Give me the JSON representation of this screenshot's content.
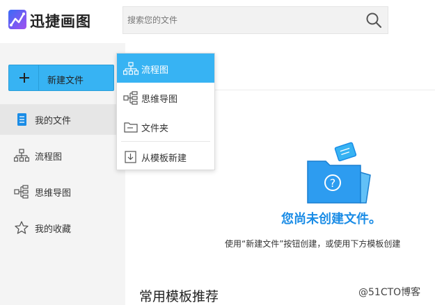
{
  "header": {
    "app_title": "迅捷画图",
    "search": {
      "placeholder": "搜索您的文件",
      "value": ""
    }
  },
  "sidebar": {
    "new_button_label": "新建文件",
    "items": [
      {
        "label": "我的文件",
        "icon": "document-icon",
        "active": true
      },
      {
        "label": "流程图",
        "icon": "flowchart-icon",
        "active": false
      },
      {
        "label": "思维导图",
        "icon": "mindmap-icon",
        "active": false
      },
      {
        "label": "我的收藏",
        "icon": "star-icon",
        "active": false
      }
    ]
  },
  "dropdown": {
    "items": [
      {
        "label": "流程图",
        "icon": "flowchart-icon",
        "highlighted": true
      },
      {
        "label": "思维导图",
        "icon": "mindmap-icon",
        "highlighted": false
      },
      {
        "label": "文件夹",
        "icon": "folder-icon",
        "highlighted": false
      },
      {
        "label": "从模板新建",
        "icon": "template-icon",
        "highlighted": false
      }
    ]
  },
  "main": {
    "empty_title": "您尚未创建文件。",
    "empty_desc": "使用“新建文件”按钮创建，或使用下方模板创建",
    "section_title": "常用模板推荐"
  },
  "watermark": "@51CTO博客",
  "colors": {
    "accent": "#37b3f3",
    "accent_text": "#1a8ce6",
    "sidebar_bg": "#f4f4f4",
    "active_bg": "#e6e6e6"
  }
}
